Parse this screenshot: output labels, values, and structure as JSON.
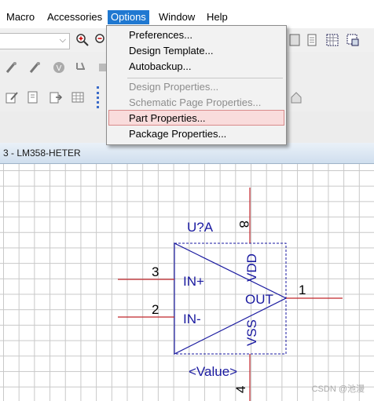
{
  "menubar": {
    "items": [
      "Macro",
      "Accessories",
      "Options",
      "Window",
      "Help"
    ],
    "active": "Options"
  },
  "options_menu": {
    "items": [
      {
        "label": "Preferences...",
        "enabled": true
      },
      {
        "label": "Design Template...",
        "enabled": true
      },
      {
        "label": "Autobackup...",
        "enabled": true
      },
      {
        "label": "Design Properties...",
        "enabled": false
      },
      {
        "label": "Schematic Page Properties...",
        "enabled": false
      },
      {
        "label": "Part Properties...",
        "enabled": true,
        "highlighted": true
      },
      {
        "label": "Package Properties...",
        "enabled": true
      }
    ]
  },
  "document": {
    "title": "3 - LM358-HETER"
  },
  "part": {
    "ref": "U?A",
    "value": "<Value>",
    "pins": [
      {
        "number": "3",
        "name": "IN+"
      },
      {
        "number": "2",
        "name": "IN-"
      },
      {
        "number": "1",
        "name": "OUT"
      },
      {
        "number": "8",
        "name": "VDD"
      },
      {
        "number": "4",
        "name": "VSS"
      }
    ]
  },
  "colors": {
    "menu_active": "#1f78d1",
    "menu_highlight": "#f9dcdc",
    "body_line": "#1a1aa0",
    "pin_line": "#c0262b",
    "grid": "#c8c8c8"
  },
  "watermark": "CSDN @池漫"
}
